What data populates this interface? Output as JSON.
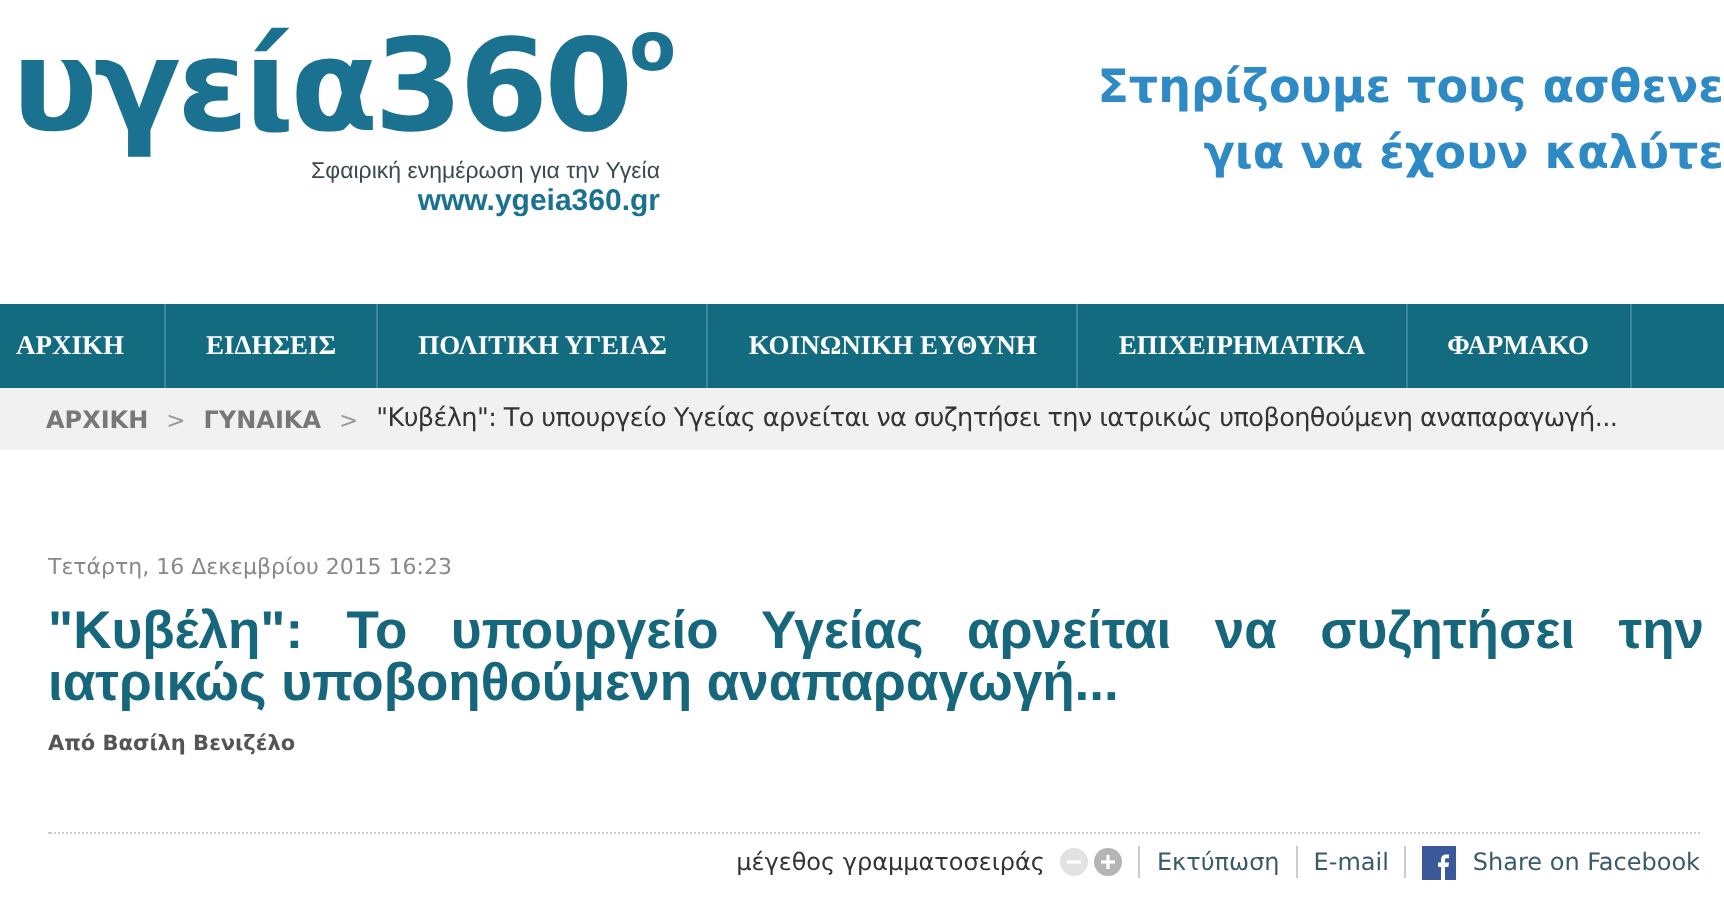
{
  "logo": {
    "wordmark": "υγεία360",
    "degree": "o",
    "tagline": "Σφαιρική ενημέρωση για την Υγεία",
    "url": "www.ygeia360.gr"
  },
  "banner": {
    "lines": [
      "Στηρίζουμε τους ασθενε",
      "για να έχουν καλύτε"
    ]
  },
  "nav": {
    "items": [
      {
        "label": "ΑΡΧΙΚΗ"
      },
      {
        "label": "ΕΙΔΗΣΕΙΣ"
      },
      {
        "label": "ΠΟΛΙΤΙΚΗ ΥΓΕΙΑΣ"
      },
      {
        "label": "ΚΟΙΝΩΝΙΚΗ ΕΥΘΥΝΗ"
      },
      {
        "label": "ΕΠΙΧΕΙΡΗΜΑΤΙΚΑ"
      },
      {
        "label": "ΦΑΡΜΑΚΟ"
      }
    ]
  },
  "breadcrumb": {
    "separator": ">",
    "items": [
      {
        "label": "ΑΡΧΙΚΗ",
        "kind": "link"
      },
      {
        "label": "ΓΥΝΑΙΚΑ",
        "kind": "link"
      },
      {
        "label": "\"Κυβέλη\": Το υπουργείο Υγείας αρνείται να συζητήσει την ιατρικώς υποβοηθούμενη αναπαραγωγή...",
        "kind": "current"
      }
    ]
  },
  "article": {
    "date": "Τετάρτη, 16 Δεκεμβρίου 2015 16:23",
    "title": "\"Κυβέλη\": Το υπουργείο Υγείας αρνείται να συζητήσει την ιατρικώς υποβοηθούμενη αναπαραγωγή...",
    "author": "Από Βασίλη Βενιζέλο"
  },
  "toolbar": {
    "font_size_label": "μέγεθος γραμματοσειράς",
    "decrease_disabled": true,
    "increase_disabled": false,
    "print": "Εκτύπωση",
    "email": "E-mail",
    "share": "Share on Facebook"
  }
}
